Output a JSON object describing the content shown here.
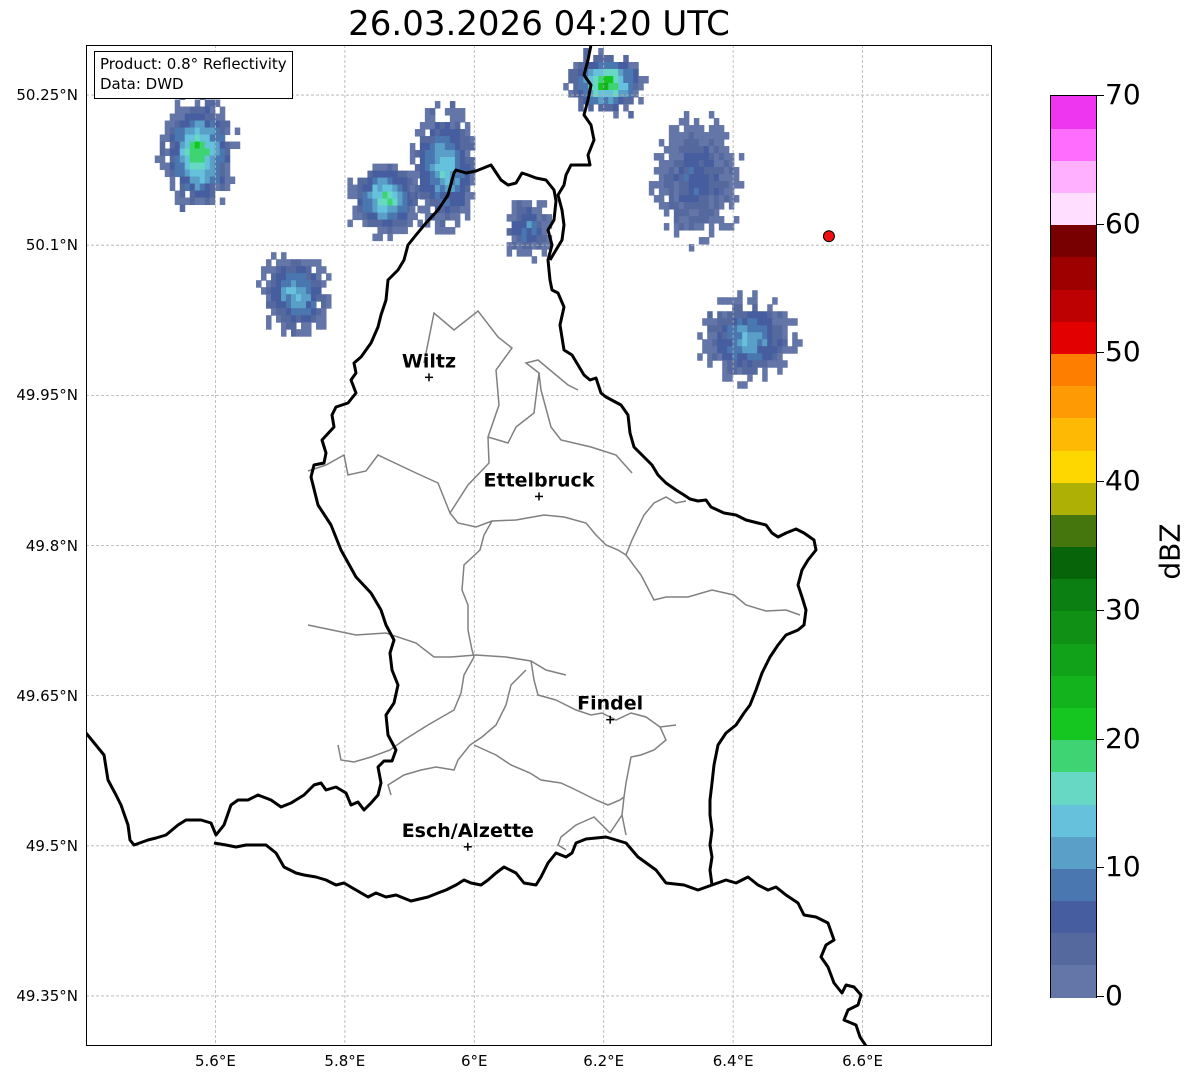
{
  "title": "26.03.2026 04:20 UTC",
  "info_box": {
    "product": "Product: 0.8° Reflectivity",
    "data": "Data: DWD"
  },
  "axes": {
    "lon_range": [
      5.4,
      6.8
    ],
    "lat_range": [
      49.3,
      50.3
    ],
    "lon_ticks": [
      {
        "value": 5.6,
        "label": "5.6°E"
      },
      {
        "value": 5.8,
        "label": "5.8°E"
      },
      {
        "value": 6.0,
        "label": "6°E"
      },
      {
        "value": 6.2,
        "label": "6.2°E"
      },
      {
        "value": 6.4,
        "label": "6.4°E"
      },
      {
        "value": 6.6,
        "label": "6.6°E"
      }
    ],
    "lat_ticks": [
      {
        "value": 50.25,
        "label": "50.25°N"
      },
      {
        "value": 50.1,
        "label": "50.1°N"
      },
      {
        "value": 49.95,
        "label": "49.95°N"
      },
      {
        "value": 49.8,
        "label": "49.8°N"
      },
      {
        "value": 49.65,
        "label": "49.65°N"
      },
      {
        "value": 49.5,
        "label": "49.5°N"
      },
      {
        "value": 49.35,
        "label": "49.35°N"
      }
    ],
    "grid": true
  },
  "cities": [
    {
      "name": "Wiltz",
      "lon": 5.93,
      "lat": 49.968
    },
    {
      "name": "Ettelbruck",
      "lon": 6.1,
      "lat": 49.849
    },
    {
      "name": "Findel",
      "lon": 6.21,
      "lat": 49.626
    },
    {
      "name": "Esch/Alzette",
      "lon": 5.99,
      "lat": 49.499
    }
  ],
  "radar_site": {
    "lon": 6.548,
    "lat": 50.109,
    "color": "#ee1111"
  },
  "colorbar": {
    "unit": "dBZ",
    "min": 0,
    "max": 70,
    "tick_labels": [
      "0",
      "10",
      "20",
      "30",
      "40",
      "50",
      "60",
      "70"
    ],
    "colors": [
      "#6475a8",
      "#55699e",
      "#465e9f",
      "#4a77b0",
      "#5a9fc8",
      "#66c2dc",
      "#66d8c4",
      "#3ed474",
      "#15c620",
      "#13b31d",
      "#12a21a",
      "#109014",
      "#0c7f12",
      "#076409",
      "#44760d",
      "#aeb005",
      "#fed600",
      "#fdb904",
      "#fe9a03",
      "#fe7e00",
      "#e30100",
      "#bd0001",
      "#9e0000",
      "#790000",
      "#ffdeff",
      "#ffb0fe",
      "#ff6dfe",
      "#ee36f1"
    ]
  },
  "echoes": [
    {
      "lon": 5.57,
      "lat": 50.195,
      "rlon": 0.055,
      "rlat": 0.055,
      "peak": 22
    },
    {
      "lon": 5.72,
      "lat": 50.055,
      "rlon": 0.05,
      "rlat": 0.04,
      "peak": 15
    },
    {
      "lon": 5.86,
      "lat": 50.15,
      "rlon": 0.055,
      "rlat": 0.035,
      "peak": 20
    },
    {
      "lon": 5.95,
      "lat": 50.18,
      "rlon": 0.05,
      "rlat": 0.06,
      "peak": 16
    },
    {
      "lon": 6.2,
      "lat": 50.265,
      "rlon": 0.06,
      "rlat": 0.03,
      "peak": 24
    },
    {
      "lon": 6.42,
      "lat": 50.01,
      "rlon": 0.07,
      "rlat": 0.04,
      "peak": 14
    },
    {
      "lon": 6.34,
      "lat": 50.17,
      "rlon": 0.06,
      "rlat": 0.06,
      "peak": 8
    },
    {
      "lon": 6.08,
      "lat": 50.12,
      "rlon": 0.035,
      "rlat": 0.03,
      "peak": 10
    }
  ]
}
